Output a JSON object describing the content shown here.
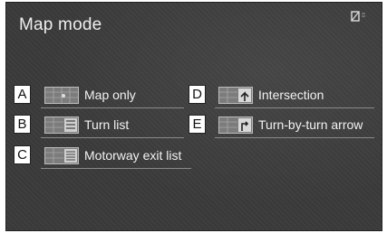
{
  "screen": {
    "title": "Map mode"
  },
  "options": [
    {
      "key": "A",
      "label": "Map only",
      "icon": "map-only-icon"
    },
    {
      "key": "B",
      "label": "Turn list",
      "icon": "turn-list-icon"
    },
    {
      "key": "C",
      "label": "Motorway exit list",
      "icon": "motorway-exit-list-icon"
    },
    {
      "key": "D",
      "label": "Intersection",
      "icon": "intersection-icon"
    },
    {
      "key": "E",
      "label": "Turn-by-turn arrow",
      "icon": "turn-by-turn-arrow-icon"
    }
  ],
  "colors": {
    "screen_bg": "#3a3a3a",
    "text": "#f2f2f2",
    "callout_bg": "#ffffff"
  }
}
